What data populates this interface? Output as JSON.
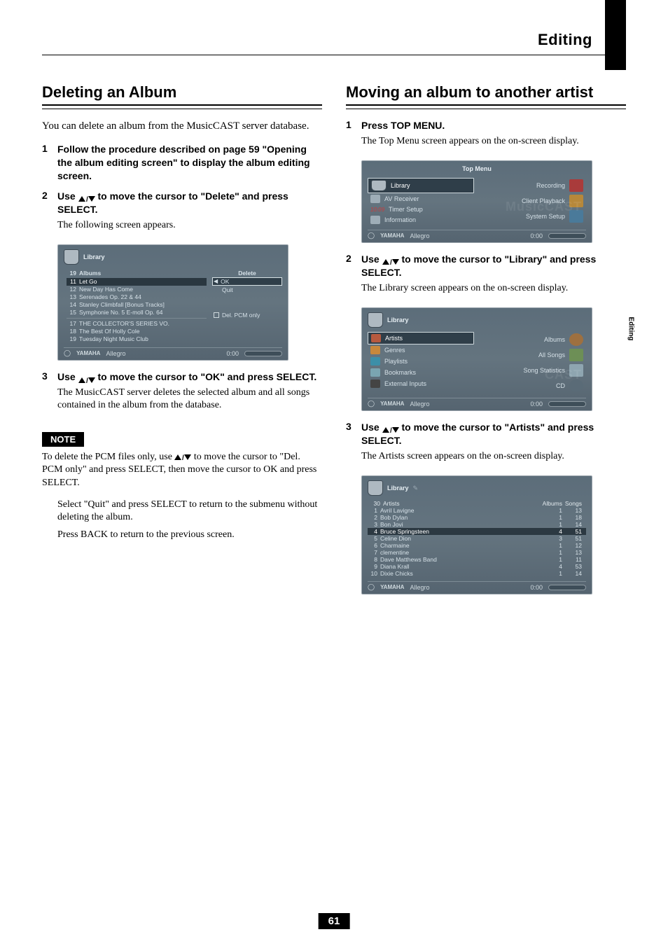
{
  "header": {
    "title": "Editing"
  },
  "side_tab": "Editing",
  "left": {
    "heading": "Deleting an Album",
    "lead": "You can delete an album from the MusicCAST server database.",
    "steps": [
      {
        "bold": "Follow the procedure described on page 59 \"Opening the album editing screen\" to display the album editing screen."
      },
      {
        "bold_pre": "Use ",
        "bold_post": " to move the cursor to \"Delete\" and press SELECT.",
        "sub": "The following screen appears."
      },
      {
        "bold_pre": "Use ",
        "bold_post": " to move the cursor to \"OK\" and press SELECT.",
        "sub": "The MusicCAST server deletes the selected album and all songs contained in the album from the database."
      }
    ],
    "note_label": "NOTE",
    "note_body_pre": "To delete the PCM files only, use ",
    "note_body_post": " to move the cursor to \"Del. PCM only\" and press SELECT, then move the cursor to OK and press SELECT.",
    "footnote_1": "Select \"Quit\" and press SELECT to return to the submenu without deleting the album.",
    "footnote_2": "Press BACK to return to the previous screen.",
    "screen": {
      "title": "Library",
      "albums_header": {
        "count": "19",
        "label": "Albums"
      },
      "rows": [
        {
          "n": "11",
          "t": "Let Go"
        },
        {
          "n": "12",
          "t": "New Day Has Come"
        },
        {
          "n": "13",
          "t": "Serenades Op. 22 & 44"
        },
        {
          "n": "14",
          "t": "Stanley Climbfall [Bonus Tracks]"
        },
        {
          "n": "15",
          "t": "Symphonie No. 5 E-moll Op. 64"
        },
        {
          "n": "17",
          "t": "THE COLLECTOR'S SERIES VO."
        },
        {
          "n": "18",
          "t": "The Best Of Holly Cole"
        },
        {
          "n": "19",
          "t": "Tuesday Night Music Club"
        }
      ],
      "actions": {
        "delete": "Delete",
        "ok": "OK",
        "quit": "Quit",
        "pcm": "Del. PCM only"
      },
      "status": {
        "brand": "YAMAHA",
        "track": "Allegro",
        "time": "0:00"
      }
    }
  },
  "right": {
    "heading": "Moving an album to another artist",
    "steps": [
      {
        "bold": "Press TOP MENU.",
        "sub": "The Top Menu screen appears on the on-screen display."
      },
      {
        "bold_pre": "Use ",
        "bold_post": " to move the cursor to \"Library\" and press SELECT.",
        "sub": "The Library screen appears on the on-screen display."
      },
      {
        "bold_pre": "Use ",
        "bold_post": " to move the cursor to \"Artists\" and press SELECT.",
        "sub": "The Artists screen appears on the on-screen display."
      }
    ],
    "screen_top": {
      "title": "Top Menu",
      "left": [
        "Library",
        "AV Receiver",
        "Timer Setup",
        "Information"
      ],
      "right": [
        "Recording",
        "Client Playback",
        "System Setup"
      ],
      "clock": "10:09",
      "status": {
        "brand": "YAMAHA",
        "track": "Allegro",
        "time": "0:00"
      }
    },
    "screen_lib": {
      "title": "Library",
      "left": [
        "Artists",
        "Genres",
        "Playlists",
        "Bookmarks",
        "External Inputs"
      ],
      "right": [
        "Albums",
        "All Songs",
        "Song Statistics",
        "CD"
      ],
      "status": {
        "brand": "YAMAHA",
        "track": "Allegro",
        "time": "0:00"
      }
    },
    "screen_artists": {
      "title": "Library",
      "header": {
        "count": "30",
        "label": "Artists",
        "col1": "Albums",
        "col2": "Songs"
      },
      "rows": [
        {
          "n": "1",
          "name": "Avril Lavigne",
          "a": "1",
          "s": "13"
        },
        {
          "n": "2",
          "name": "Bob Dylan",
          "a": "1",
          "s": "18"
        },
        {
          "n": "3",
          "name": "Bon Jovi",
          "a": "1",
          "s": "14"
        },
        {
          "n": "4",
          "name": "Bruce Springsteen",
          "a": "4",
          "s": "51"
        },
        {
          "n": "5",
          "name": "Celine Dion",
          "a": "3",
          "s": "51"
        },
        {
          "n": "6",
          "name": "Charmaine",
          "a": "1",
          "s": "12"
        },
        {
          "n": "7",
          "name": "clementine",
          "a": "1",
          "s": "13"
        },
        {
          "n": "8",
          "name": "Dave Matthews Band",
          "a": "1",
          "s": "11"
        },
        {
          "n": "9",
          "name": "Diana Krall",
          "a": "4",
          "s": "53"
        },
        {
          "n": "10",
          "name": "Dixie Chicks",
          "a": "1",
          "s": "14"
        }
      ],
      "status": {
        "brand": "YAMAHA",
        "track": "Allegro",
        "time": "0:00"
      }
    }
  },
  "page_num": "61"
}
